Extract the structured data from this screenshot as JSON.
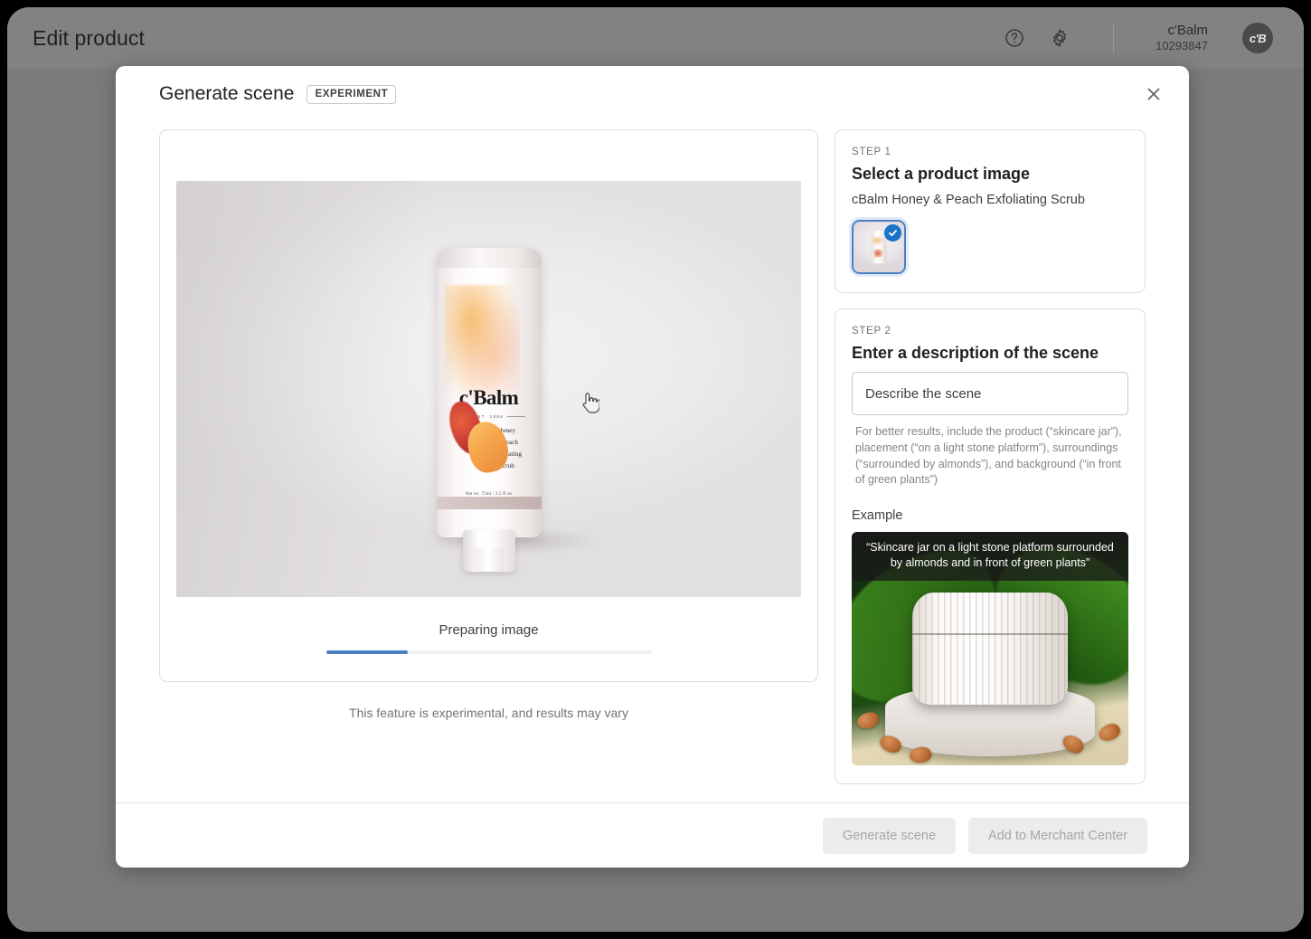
{
  "appbar": {
    "title": "Edit product",
    "help_icon": "help-circle-icon",
    "settings_icon": "gear-icon",
    "account_name": "c'Balm",
    "account_id": "10293847",
    "avatar_initials": "c'B"
  },
  "dialog": {
    "title": "Generate scene",
    "badge": "EXPERIMENT",
    "close_label": "✕"
  },
  "preview": {
    "product_brand": "c'Balm",
    "product_est": "EST. 1986",
    "product_subtitle": "Honey\n& Peach\nExfoliating\nScrub",
    "product_netwt": "Net wt. 75ml / 2.5 fl oz",
    "progress_label": "Preparing image",
    "progress_percent": 25,
    "disclaimer": "This feature is experimental, and results may vary"
  },
  "step1": {
    "kicker": "STEP 1",
    "title": "Select a product image",
    "product_name": "cBalm Honey & Peach Exfoliating Scrub",
    "thumb_selected": true
  },
  "step2": {
    "kicker": "STEP 2",
    "title": "Enter a description of the scene",
    "input_value": "",
    "input_placeholder": "Describe the scene",
    "hint": "For better results, include the product (“skincare jar”), placement (“on a light stone platform”), surroundings (“surrounded by almonds”), and background (“in front of green plants”)",
    "example_label": "Example",
    "example_caption": "“Skincare jar on a light stone platform surrounded by almonds and in front of green plants”"
  },
  "footer": {
    "generate_label": "Generate scene",
    "add_label": "Add to Merchant Center",
    "generate_disabled": true,
    "add_disabled": true
  },
  "colors": {
    "accent_blue": "#4a7fc1",
    "check_blue": "#1a73c8",
    "page_bg": "#7b7b7b",
    "appbar_bg": "#828282"
  }
}
